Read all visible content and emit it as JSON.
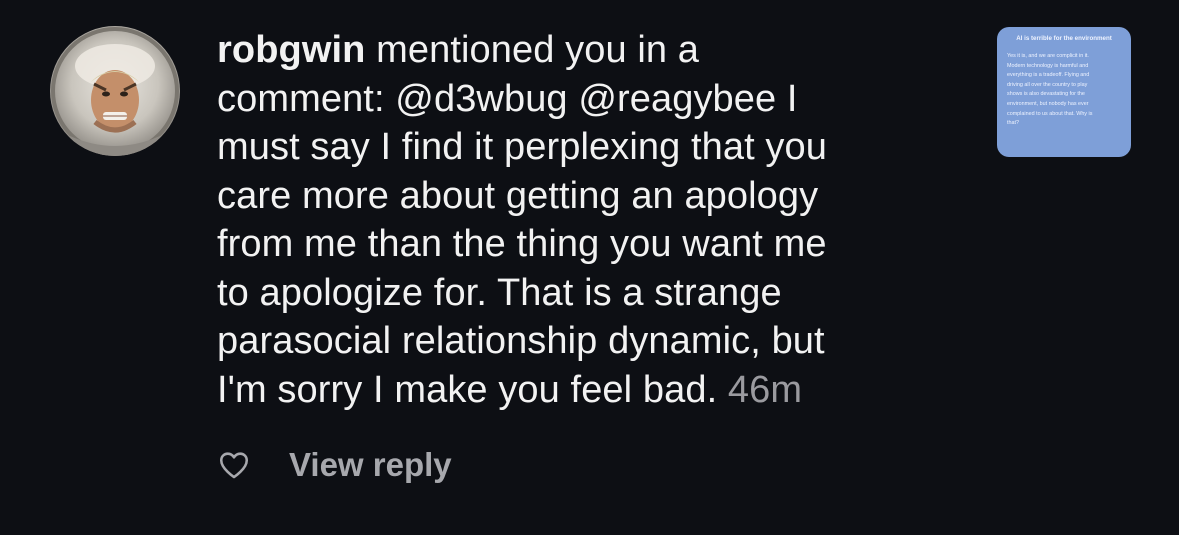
{
  "comment": {
    "username": "robgwin",
    "lines": [
      " mentioned you in a",
      "comment: @d3wbug @reagybee I",
      "must say I find it perplexing that you",
      "care more about getting an apology",
      "from me than the thing you want me",
      "to apologize for. That is a strange",
      "parasocial relationship dynamic, but",
      "I'm sorry I make you feel bad. "
    ],
    "time": "46m"
  },
  "thumbnail": {
    "title": "AI is terrible for the environment",
    "lines": [
      "Yes it is, and we are complicit in it.",
      "Modern technology is harmful and",
      "everything is a tradeoff. Flying and",
      "driving all over the country to play",
      "shows is also devastating for the",
      "environment, but nobody has ever",
      "complained to us about that. Why is",
      "that?"
    ],
    "background": "#7e9fd8"
  },
  "actions": {
    "like_icon": "heart-outline-icon",
    "view_reply_label": "View reply"
  },
  "colors": {
    "background": "#0d0f14",
    "text": "#f2f2f2",
    "muted": "#9a9a9f"
  }
}
